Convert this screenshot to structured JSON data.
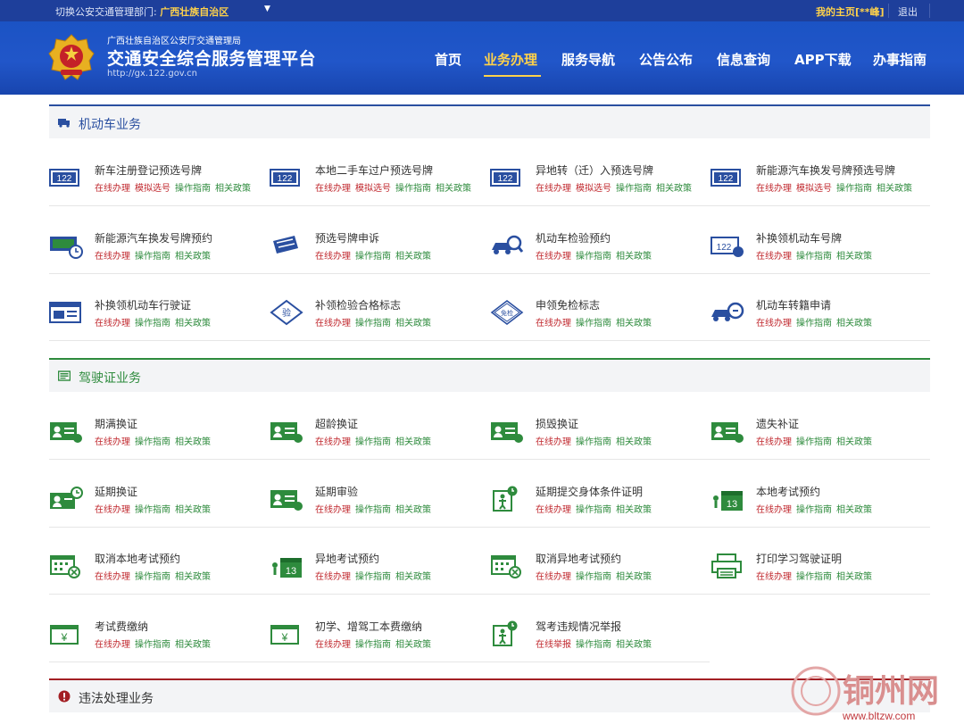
{
  "topbar": {
    "switch_label": "切换公安交通管理部门:",
    "region": "广西壮族自治区",
    "my_home": "我的主页[**峰]",
    "logout": "退出"
  },
  "header": {
    "org": "广西壮族自治区公安厅交通管理局",
    "platform": "交通安全综合服务管理平台",
    "url": "http://gx.122.gov.cn"
  },
  "nav": [
    "首页",
    "业务办理",
    "服务导航",
    "公告公布",
    "信息查询",
    "APP下载",
    "办事指南"
  ],
  "sections": {
    "vehicle": {
      "title": "机动车业务",
      "color": "#2a4fa0",
      "items": [
        {
          "name": "新车注册登记预选号牌",
          "links": [
            "在线办理",
            "模拟选号",
            "操作指南",
            "相关政策"
          ],
          "icon": "plate-122-icon"
        },
        {
          "name": "本地二手车过户预选号牌",
          "links": [
            "在线办理",
            "模拟选号",
            "操作指南",
            "相关政策"
          ],
          "icon": "plate-122-icon"
        },
        {
          "name": "异地转（迁）入预选号牌",
          "links": [
            "在线办理",
            "模拟选号",
            "操作指南",
            "相关政策"
          ],
          "icon": "plate-122-icon"
        },
        {
          "name": "新能源汽车换发号牌预选号牌",
          "links": [
            "在线办理",
            "模拟选号",
            "操作指南",
            "相关政策"
          ],
          "icon": "plate-122-icon"
        },
        {
          "name": "新能源汽车换发号牌预约",
          "links": [
            "在线办理",
            "操作指南",
            "相关政策"
          ],
          "icon": "plate-clock-icon"
        },
        {
          "name": "预选号牌申诉",
          "links": [
            "在线办理",
            "操作指南",
            "相关政策"
          ],
          "icon": "plate-appeal-icon"
        },
        {
          "name": "机动车检验预约",
          "links": [
            "在线办理",
            "操作指南",
            "相关政策"
          ],
          "icon": "car-inspect-icon"
        },
        {
          "name": "补换领机动车号牌",
          "links": [
            "在线办理",
            "操作指南",
            "相关政策"
          ],
          "icon": "plate-replace-icon"
        },
        {
          "name": "补换领机动车行驶证",
          "links": [
            "在线办理",
            "操作指南",
            "相关政策"
          ],
          "icon": "license-card-icon"
        },
        {
          "name": "补领检验合格标志",
          "links": [
            "在线办理",
            "操作指南",
            "相关政策"
          ],
          "icon": "inspect-sign-icon"
        },
        {
          "name": "申领免检标志",
          "links": [
            "在线办理",
            "操作指南",
            "相关政策"
          ],
          "icon": "exempt-sign-icon"
        },
        {
          "name": "机动车转籍申请",
          "links": [
            "在线办理",
            "操作指南",
            "相关政策"
          ],
          "icon": "car-transfer-icon"
        }
      ]
    },
    "driver": {
      "title": "驾驶证业务",
      "color": "#2e8b3d",
      "items": [
        {
          "name": "期满换证",
          "links": [
            "在线办理",
            "操作指南",
            "相关政策"
          ],
          "icon": "id-card-icon"
        },
        {
          "name": "超龄换证",
          "links": [
            "在线办理",
            "操作指南",
            "相关政策"
          ],
          "icon": "id-card-icon"
        },
        {
          "name": "损毁换证",
          "links": [
            "在线办理",
            "操作指南",
            "相关政策"
          ],
          "icon": "id-card-icon"
        },
        {
          "name": "遗失补证",
          "links": [
            "在线办理",
            "操作指南",
            "相关政策"
          ],
          "icon": "id-card-icon"
        },
        {
          "name": "延期换证",
          "links": [
            "在线办理",
            "操作指南",
            "相关政策"
          ],
          "icon": "id-card-clock-icon"
        },
        {
          "name": "延期审验",
          "links": [
            "在线办理",
            "操作指南",
            "相关政策"
          ],
          "icon": "id-card-icon"
        },
        {
          "name": "延期提交身体条件证明",
          "links": [
            "在线办理",
            "操作指南",
            "相关政策"
          ],
          "icon": "person-clock-icon"
        },
        {
          "name": "本地考试预约",
          "links": [
            "在线办理",
            "操作指南",
            "相关政策"
          ],
          "icon": "calendar-13-icon"
        },
        {
          "name": "取消本地考试预约",
          "links": [
            "在线办理",
            "操作指南",
            "相关政策"
          ],
          "icon": "calendar-cancel-icon"
        },
        {
          "name": "异地考试预约",
          "links": [
            "在线办理",
            "操作指南",
            "相关政策"
          ],
          "icon": "calendar-13-icon"
        },
        {
          "name": "取消异地考试预约",
          "links": [
            "在线办理",
            "操作指南",
            "相关政策"
          ],
          "icon": "calendar-cancel-icon"
        },
        {
          "name": "打印学习驾驶证明",
          "links": [
            "在线办理",
            "操作指南",
            "相关政策"
          ],
          "icon": "printer-icon"
        },
        {
          "name": "考试费缴纳",
          "links": [
            "在线办理",
            "操作指南",
            "相关政策"
          ],
          "icon": "yen-payment-icon"
        },
        {
          "name": "初学、增驾工本费缴纳",
          "links": [
            "在线办理",
            "操作指南",
            "相关政策"
          ],
          "icon": "yen-payment-icon"
        },
        {
          "name": "驾考违规情况举报",
          "links": [
            "在线举报",
            "操作指南",
            "相关政策"
          ],
          "icon": "person-clock-icon"
        }
      ]
    },
    "violation": {
      "title": "违法处理业务",
      "color": "#a31f24"
    }
  },
  "watermark": {
    "site": "铜州网",
    "url": "www.bltzw.com"
  }
}
